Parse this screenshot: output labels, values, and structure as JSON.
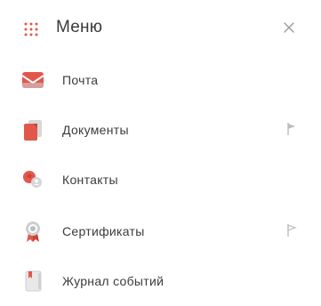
{
  "header": {
    "title": "Меню",
    "menu_icon": "grid-dots-icon",
    "close_icon": "close-icon"
  },
  "menu": {
    "items": [
      {
        "label": "Почта",
        "icon": "mail-icon",
        "pinned": false,
        "selected": false
      },
      {
        "label": "Документы",
        "icon": "documents-icon",
        "pinned": true,
        "selected": false
      },
      {
        "label": "Контакты",
        "icon": "contacts-icon",
        "pinned": false,
        "selected": false
      },
      {
        "label": "Сертификаты",
        "icon": "certificate-icon",
        "pinned": true,
        "selected": true
      },
      {
        "label": "Журнал событий",
        "icon": "event-log-icon",
        "pinned": false,
        "selected": false
      }
    ]
  },
  "colors": {
    "accent": "#e2574c",
    "accent_dark": "#c94437",
    "selection_border": "#d9534f",
    "icon_gray": "#bdbdbd",
    "text": "#3b3b3b"
  }
}
